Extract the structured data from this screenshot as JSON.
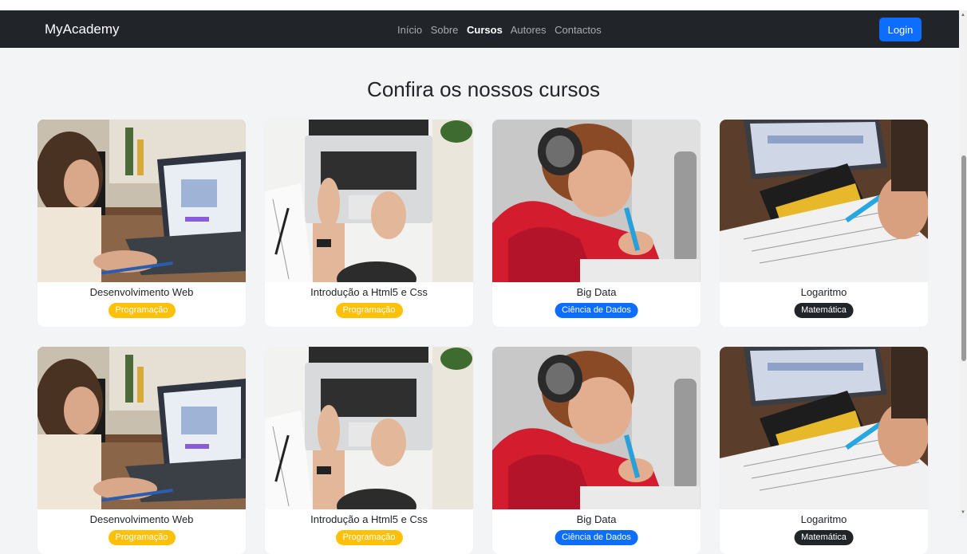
{
  "navbar": {
    "brand": "MyAcademy",
    "links": [
      "Início",
      "Sobre",
      "Cursos",
      "Autores",
      "Contactos"
    ],
    "active_link": "Cursos",
    "login_label": "Login"
  },
  "heading": "Confira os nossos cursos",
  "courses": [
    {
      "title": "Desenvolvimento Web",
      "category": "Programação",
      "badge_color": "#ffc107",
      "image": "laptop-study-photo"
    },
    {
      "title": "Introdução a Html5 e Css",
      "category": "Programação",
      "badge_color": "#ffc107",
      "image": "typing-laptop-photo"
    },
    {
      "title": "Big Data",
      "category": "Ciência de Dados",
      "badge_color": "#0d6efd",
      "image": "boy-headphones-photo"
    },
    {
      "title": "Logaritmo",
      "category": "Matemática",
      "badge_color": "#212529",
      "image": "math-book-photo"
    },
    {
      "title": "Desenvolvimento Web",
      "category": "Programação",
      "badge_color": "#ffc107",
      "image": "laptop-study-photo"
    },
    {
      "title": "Introdução a Html5 e Css",
      "category": "Programação",
      "badge_color": "#ffc107",
      "image": "typing-laptop-photo"
    },
    {
      "title": "Big Data",
      "category": "Ciência de Dados",
      "badge_color": "#0d6efd",
      "image": "boy-headphones-photo"
    },
    {
      "title": "Logaritmo",
      "category": "Matemática",
      "badge_color": "#212529",
      "image": "math-book-photo"
    }
  ]
}
